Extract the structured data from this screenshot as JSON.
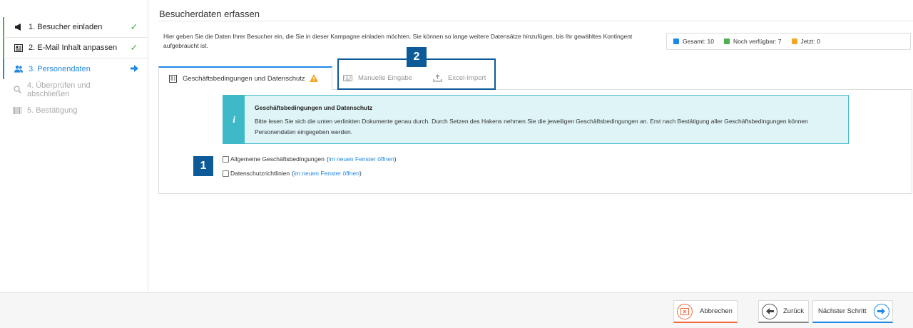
{
  "sidebar": {
    "steps": [
      {
        "label": "1. Besucher einladen",
        "icon": "megaphone-icon",
        "state": "done"
      },
      {
        "label": "2. E-Mail Inhalt anpassen",
        "icon": "newspaper-icon",
        "state": "done"
      },
      {
        "label": "3. Personendaten",
        "icon": "users-icon",
        "state": "active"
      },
      {
        "label": "4. Überprüfen und abschließen",
        "icon": "search-icon",
        "state": "disabled"
      },
      {
        "label": "5. Bestätigung",
        "icon": "barcode-icon",
        "state": "disabled"
      }
    ]
  },
  "main": {
    "title": "Besucherdaten erfassen",
    "intro": "Hier geben Sie die Daten Ihrer Besucher ein, die Sie in dieser Kampagne einladen möchten. Sie können so lange weitere Datensätze hinzufügen, bis Ihr gewähltes Kontingent aufgebraucht ist.",
    "counters": [
      {
        "label": "Gesamt: 10",
        "color": "#1e88e5"
      },
      {
        "label": "Noch verfügbar: 7",
        "color": "#4caf50"
      },
      {
        "label": "Jetzt: 0",
        "color": "#f5a623"
      }
    ],
    "tabs": [
      {
        "label": "Geschäftsbedingungen und Datenschutz",
        "icon": "document-icon",
        "active": true
      },
      {
        "label": "Manuelle Eingabe",
        "icon": "keyboard-icon",
        "active": false
      },
      {
        "label": "Excel-Import",
        "icon": "upload-icon",
        "active": false
      }
    ],
    "info": {
      "icon_text": "i",
      "title": "Geschäftsbedingungen und Datenschutz",
      "text": "Bitte lesen Sie sich die unten verlinkten Dokumente genau durch. Durch Setzen des Hakens nehmen Sie die jeweiligen Geschäftsbedingungen an. Erst nach Bestätigung aller Geschäftsbedingungen können Personendaten eingegeben werden."
    },
    "checkboxes": [
      {
        "label": "Allgemeine Geschäftsbedingungen",
        "open_paren": "(",
        "link": "im neuen Fenster öffnen",
        "close_paren": ")",
        "checked": false
      },
      {
        "label": "Datenschutzrichtlinien",
        "open_paren": "(",
        "link": "im neuen Fenster öffnen",
        "close_paren": ")",
        "checked": false
      }
    ]
  },
  "callouts": {
    "one": "1",
    "two": "2"
  },
  "footer": {
    "cancel": "Abbrechen",
    "back": "Zurück",
    "next": "Nächster Schritt"
  },
  "colors": {
    "accent": "#1e88e5",
    "success": "#4caf50",
    "warning": "#f5a623",
    "info": "#3fb9c7",
    "callout": "#0d5a99",
    "cancel": "#f26b3a"
  }
}
